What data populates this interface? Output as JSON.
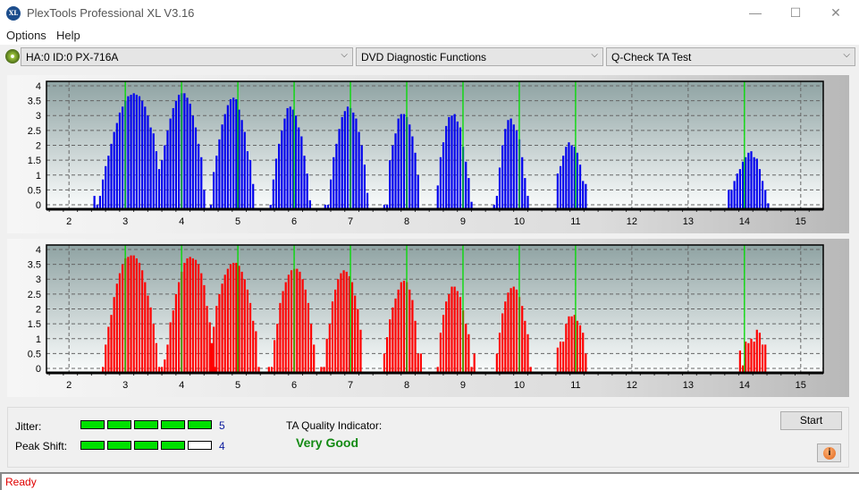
{
  "window": {
    "title": "PlexTools Professional XL V3.16",
    "app_icon_text": "XL",
    "minimize": "—",
    "maximize": "☐",
    "close": "✕"
  },
  "menu": {
    "items": [
      {
        "label": "Options"
      },
      {
        "label": "Help"
      }
    ]
  },
  "toolbar": {
    "drive_select": "HA:0 ID:0  PX-716A",
    "function_select": "DVD Diagnostic Functions",
    "test_select": "Q-Check TA Test",
    "chevron": "⌵"
  },
  "results": {
    "jitter_label": "Jitter:",
    "jitter_value": "5",
    "jitter_score": 5,
    "peak_shift_label": "Peak Shift:",
    "peak_shift_value": "4",
    "peak_shift_score": 4,
    "meter_max": 5,
    "ta_label": "TA Quality Indicator:",
    "ta_value": "Very Good"
  },
  "buttons": {
    "start": "Start",
    "info": "i"
  },
  "status": {
    "text": "Ready"
  },
  "colors": {
    "upper_bars": "#0000ee",
    "lower_bars": "#ff0000",
    "peak_lines": "#00dd00",
    "meter_on": "#00e000",
    "ta_good": "#138a13",
    "status": "#e00000"
  },
  "chart_data": [
    {
      "type": "bar",
      "name": "upper-ta-histogram",
      "xlim": [
        1.6,
        15.4
      ],
      "ylim": [
        -0.15,
        4.15
      ],
      "xticks": [
        2,
        3,
        4,
        5,
        6,
        7,
        8,
        9,
        10,
        11,
        12,
        13,
        14,
        15
      ],
      "yticks": [
        0,
        0.5,
        1,
        1.5,
        2,
        2.5,
        3,
        3.5,
        4
      ],
      "ytick_labels": [
        "0",
        "0.5",
        "1",
        "1.5",
        "2",
        "2.5",
        "3",
        "3.5",
        "4"
      ],
      "grid": true,
      "peak_markers": [
        3,
        4,
        5,
        6,
        7,
        8,
        9,
        10,
        11,
        14
      ],
      "clusters": [
        {
          "start": 2.45,
          "values": [
            0.3,
            0,
            0.3,
            0.85,
            1.3,
            1.65,
            2.05,
            2.45,
            2.75,
            3.1,
            3.3,
            3.5,
            3.65,
            3.7,
            3.75,
            3.7,
            3.65,
            3.5,
            3.3,
            3.0,
            2.6,
            2.4,
            1.8,
            1.2,
            1.5,
            2.0,
            2.5,
            2.9,
            3.25,
            3.5,
            3.7,
            3.75,
            3.75,
            3.6,
            3.4,
            3.0,
            2.6,
            2.05,
            1.6,
            0.5
          ]
        },
        {
          "start": 4.52,
          "values": [
            0,
            1.1,
            1.65,
            2.2,
            2.7,
            3.05,
            3.35,
            3.55,
            3.6,
            3.55,
            3.2,
            2.85,
            2.45,
            1.8,
            1.5,
            0.7
          ]
        },
        {
          "start": 5.58,
          "values": [
            0,
            0.85,
            1.55,
            2.05,
            2.5,
            2.9,
            3.25,
            3.3,
            3.2,
            3.0,
            2.6,
            2.3,
            1.65,
            1.05,
            0.15
          ]
        },
        {
          "start": 6.55,
          "values": [
            0,
            0,
            0.85,
            1.6,
            2.05,
            2.55,
            2.95,
            3.15,
            3.3,
            3.25,
            3.1,
            2.9,
            2.45,
            2.0,
            1.35,
            0.4
          ]
        },
        {
          "start": 7.6,
          "values": [
            0,
            0,
            1.5,
            2.0,
            2.4,
            2.9,
            3.05,
            3.05,
            2.95,
            2.7,
            2.3,
            1.75,
            1.0
          ]
        },
        {
          "start": 8.55,
          "values": [
            0.65,
            1.6,
            2.1,
            2.65,
            2.95,
            3.0,
            3.05,
            2.8,
            2.6,
            1.95,
            1.45,
            0.9,
            0.1
          ]
        },
        {
          "start": 9.55,
          "values": [
            0,
            0.3,
            1.25,
            2.0,
            2.55,
            2.85,
            2.9,
            2.7,
            2.5,
            2.2,
            1.6,
            0.9,
            0.3
          ]
        },
        {
          "start": 10.68,
          "values": [
            1.05,
            1.3,
            1.65,
            1.95,
            2.1,
            2.0,
            1.95,
            1.75,
            1.35,
            0.8,
            0.7
          ]
        },
        {
          "start": 13.72,
          "values": [
            0.5,
            0.5,
            0.8,
            1.05,
            1.2,
            1.45,
            1.6,
            1.75,
            1.8,
            1.6,
            1.55,
            1.2,
            0.8,
            0.5,
            0.05
          ]
        }
      ],
      "bar_step": 0.05
    },
    {
      "type": "bar",
      "name": "lower-ta-histogram",
      "xlim": [
        1.6,
        15.4
      ],
      "ylim": [
        -0.15,
        4.15
      ],
      "xticks": [
        2,
        3,
        4,
        5,
        6,
        7,
        8,
        9,
        10,
        11,
        12,
        13,
        14,
        15
      ],
      "yticks": [
        0,
        0.5,
        1,
        1.5,
        2,
        2.5,
        3,
        3.5,
        4
      ],
      "ytick_labels": [
        "0",
        "0.5",
        "1",
        "1.5",
        "2",
        "2.5",
        "3",
        "3.5",
        "4"
      ],
      "grid": true,
      "peak_markers": [
        3,
        4,
        5,
        6,
        7,
        8,
        9,
        10,
        11,
        14
      ],
      "clusters": [
        {
          "start": 2.6,
          "values": [
            0.05,
            0.8,
            1.4,
            1.8,
            2.4,
            2.85,
            3.2,
            3.5,
            3.7,
            3.75,
            3.8,
            3.8,
            3.7,
            3.55,
            3.3,
            2.9,
            2.45,
            2.05,
            1.5,
            0.85,
            0.05,
            0.05,
            0.3,
            0.8,
            1.55,
            1.95,
            2.5,
            2.9,
            3.25,
            3.55,
            3.7,
            3.75,
            3.7,
            3.65,
            3.5,
            3.2,
            2.8,
            2.1,
            1.55,
            0.85,
            0.05
          ]
        },
        {
          "start": 4.52,
          "values": [
            0.85,
            1.4,
            2.1,
            2.5,
            2.85,
            3.15,
            3.35,
            3.5,
            3.55,
            3.55,
            3.45,
            3.25,
            3.0,
            2.65,
            2.2,
            1.6,
            1.25,
            0.05
          ]
        },
        {
          "start": 5.55,
          "values": [
            0.05,
            0.05,
            0.95,
            1.5,
            2.2,
            2.6,
            2.9,
            3.15,
            3.3,
            3.35,
            3.35,
            3.25,
            3.0,
            2.65,
            2.2,
            1.5,
            0.8
          ]
        },
        {
          "start": 6.48,
          "values": [
            0.05,
            0.05,
            1.0,
            1.5,
            2.25,
            2.65,
            3.0,
            3.2,
            3.3,
            3.25,
            3.1,
            2.9,
            2.45,
            2.0,
            1.3
          ]
        },
        {
          "start": 7.6,
          "values": [
            0.5,
            1.05,
            1.65,
            2.05,
            2.35,
            2.65,
            2.9,
            2.95,
            2.9,
            2.65,
            2.3,
            1.6,
            0.5,
            0.5
          ]
        },
        {
          "start": 8.55,
          "values": [
            0.05,
            1.2,
            1.8,
            2.25,
            2.5,
            2.75,
            2.75,
            2.6,
            2.4,
            1.95,
            1.5,
            1.15,
            0.05,
            0.5
          ]
        },
        {
          "start": 9.6,
          "values": [
            0.5,
            1.2,
            1.85,
            2.25,
            2.55,
            2.7,
            2.75,
            2.65,
            2.4,
            2.1,
            1.6,
            1.15,
            0.05
          ]
        },
        {
          "start": 10.68,
          "values": [
            0.7,
            0.9,
            0.9,
            1.5,
            1.75,
            1.75,
            1.8,
            1.6,
            1.45,
            1.2,
            0.5
          ]
        },
        {
          "start": 13.92,
          "values": [
            0.6,
            0.1,
            0.9,
            0.85,
            1.0,
            0.9,
            1.3,
            1.2,
            0.8,
            0.8
          ]
        }
      ],
      "bar_step": 0.05
    }
  ]
}
